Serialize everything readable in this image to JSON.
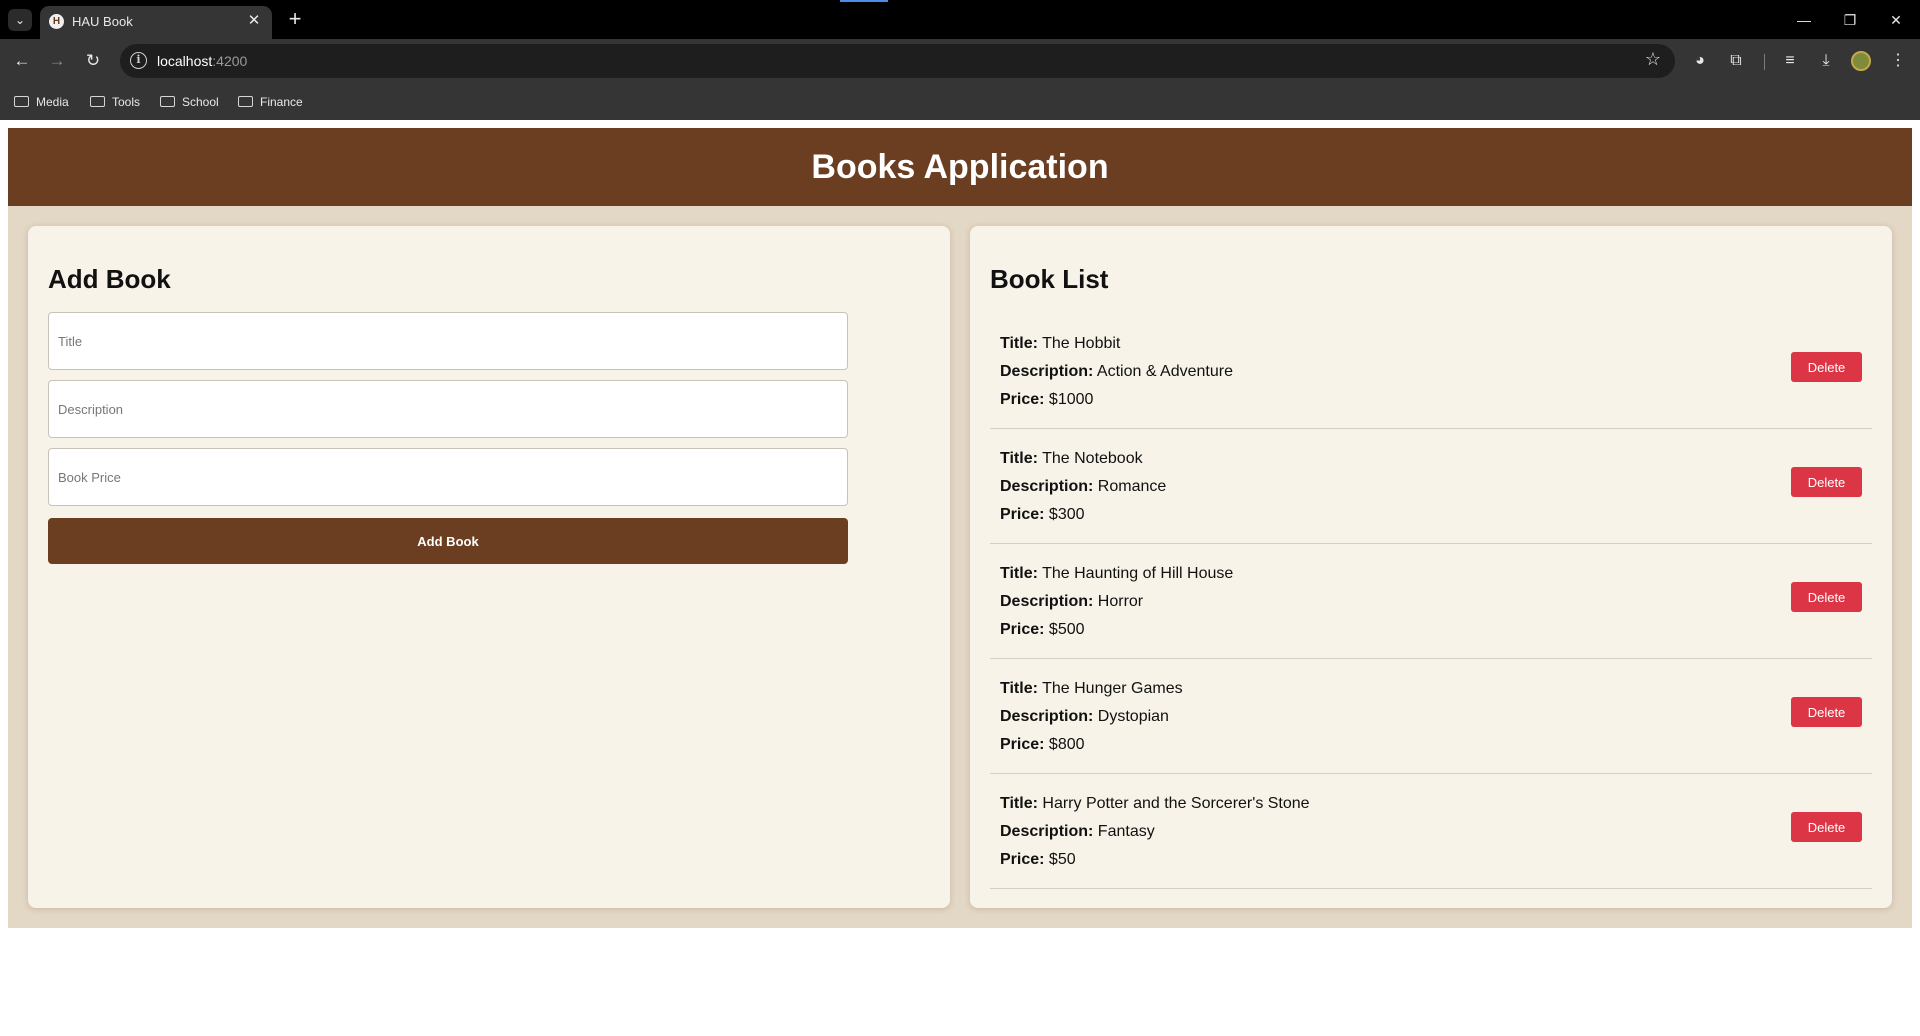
{
  "browser": {
    "tab_title": "HAU Book",
    "url_host": "localhost",
    "url_port": ":4200",
    "bookmarks": [
      "Media",
      "Tools",
      "School",
      "Finance"
    ]
  },
  "app": {
    "title": "Books Application"
  },
  "add_book": {
    "heading": "Add Book",
    "title_placeholder": "Title",
    "description_placeholder": "Description",
    "price_placeholder": "Book Price",
    "submit_label": "Add Book"
  },
  "book_list": {
    "heading": "Book List",
    "title_label": "Title:",
    "description_label": "Description:",
    "price_label": "Price:",
    "delete_label": "Delete",
    "books": [
      {
        "title": "The Hobbit",
        "description": "Action & Adventure",
        "price": "$1000"
      },
      {
        "title": "The Notebook",
        "description": "Romance",
        "price": "$300"
      },
      {
        "title": "The Haunting of Hill House",
        "description": "Horror",
        "price": "$500"
      },
      {
        "title": "The Hunger Games",
        "description": "Dystopian",
        "price": "$800"
      },
      {
        "title": "Harry Potter and the Sorcerer's Stone",
        "description": "Fantasy",
        "price": "$50"
      }
    ]
  },
  "colors": {
    "header_brown": "#6b3e22",
    "page_background": "#e3d7c5",
    "card_background": "#f8f3e9",
    "delete_red": "#dc3545"
  }
}
